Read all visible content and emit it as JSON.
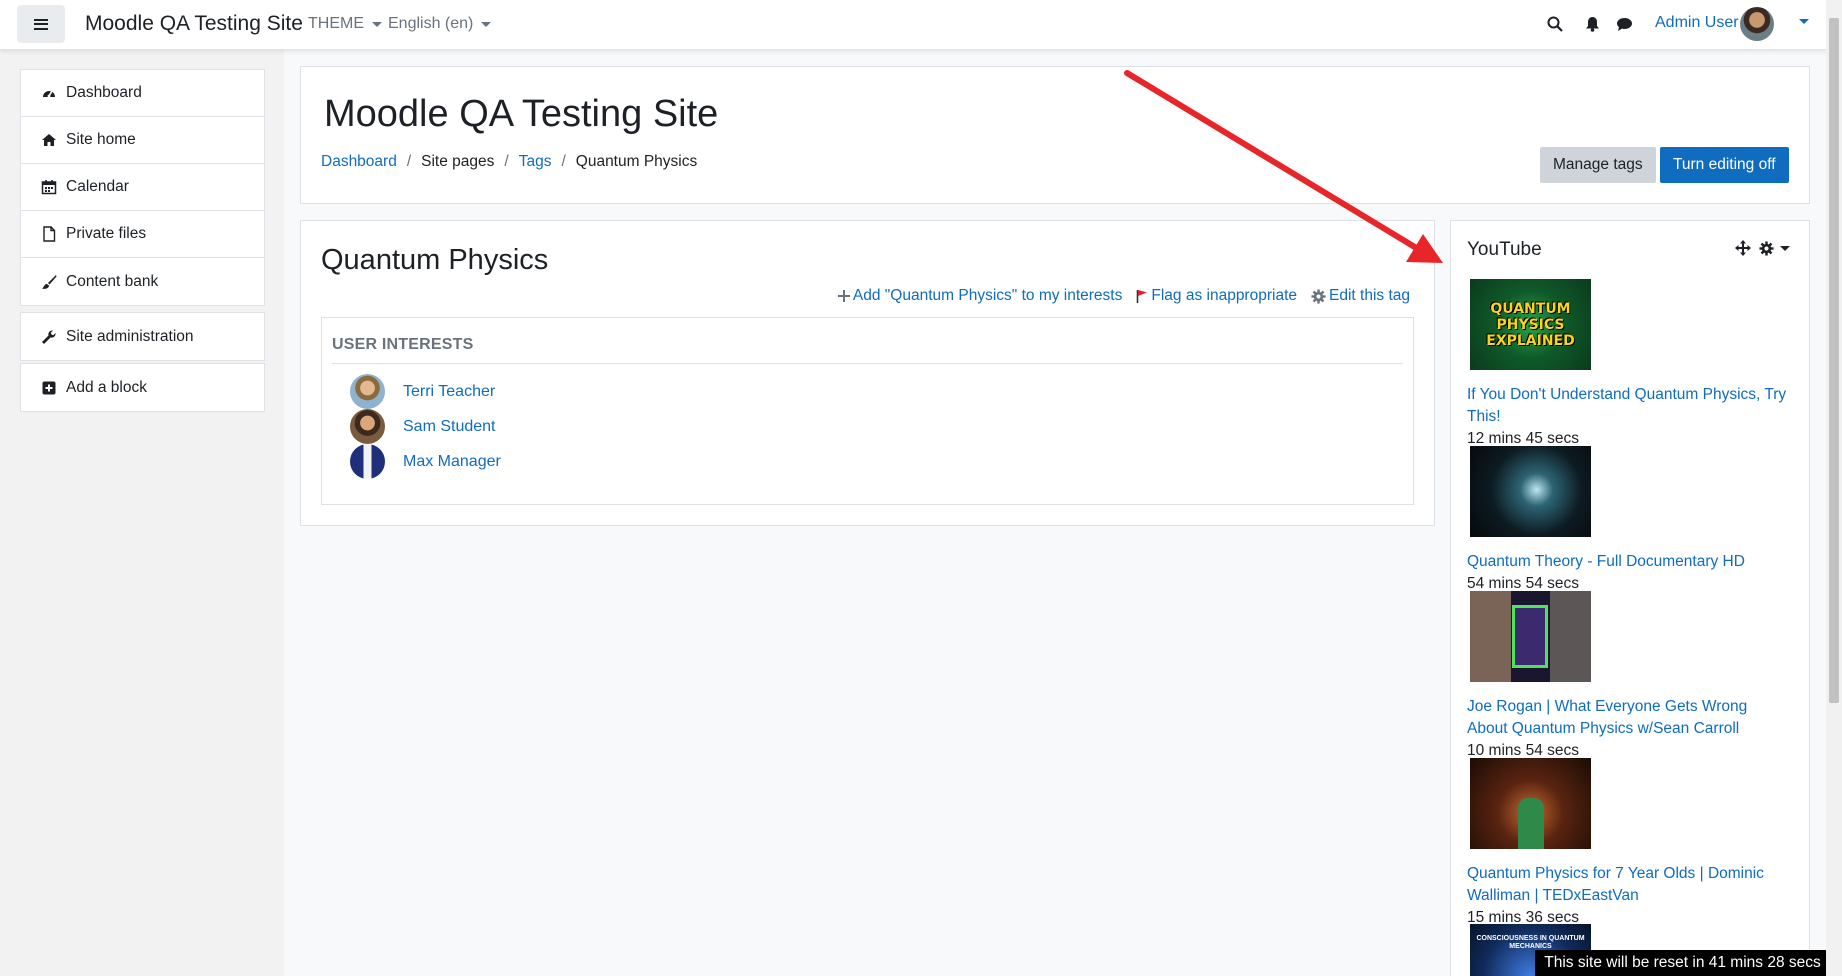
{
  "navbar": {
    "brand": "Moodle QA Testing Site",
    "theme_menu": "THEME",
    "language_menu": "English (en)",
    "user_name": "Admin User"
  },
  "drawer": {
    "items": [
      {
        "label": "Dashboard",
        "icon": "dashboard-icon"
      },
      {
        "label": "Site home",
        "icon": "home-icon"
      },
      {
        "label": "Calendar",
        "icon": "calendar-icon"
      },
      {
        "label": "Private files",
        "icon": "file-icon"
      },
      {
        "label": "Content bank",
        "icon": "brush-icon"
      }
    ],
    "admin": {
      "label": "Site administration",
      "icon": "wrench-icon"
    },
    "add_block": {
      "label": "Add a block",
      "icon": "plus-square-icon"
    }
  },
  "header": {
    "title": "Moodle QA Testing Site",
    "breadcrumb": [
      "Dashboard",
      "Site pages",
      "Tags",
      "Quantum Physics"
    ],
    "manage_tags": "Manage tags",
    "turn_editing_off": "Turn editing off"
  },
  "tag": {
    "name": "Quantum Physics",
    "add_interest": "Add \"Quantum Physics\" to my interests",
    "flag": "Flag as inappropriate",
    "edit": "Edit this tag",
    "interests_heading": "USER INTERESTS",
    "users": [
      "Terri Teacher",
      "Sam Student",
      "Max Manager"
    ]
  },
  "youtube": {
    "title": "YouTube",
    "videos": [
      {
        "title": "If You Don't Understand Quantum Physics, Try This!",
        "length": "12 mins 45 secs",
        "thumb_text": "QUANTUM PHYSICS EXPLAINED"
      },
      {
        "title": "Quantum Theory - Full Documentary HD",
        "length": "54 mins 54 secs"
      },
      {
        "title": "Joe Rogan | What Everyone Gets Wrong About Quantum Physics w/Sean Carroll",
        "length": "10 mins 54 secs"
      },
      {
        "title": "Quantum Physics for 7 Year Olds | Dominic Walliman | TEDxEastVan",
        "length": "15 mins 36 secs"
      }
    ],
    "fifth_thumb_text": "CONSCIOUSNESS IN QUANTUM MECHANICS"
  },
  "footer": {
    "reset_notice": "This site will be reset in 41 mins 28 secs"
  },
  "colors": {
    "link": "#0f6cbf",
    "primary": "#0f6cbf",
    "annotation_arrow": "#e8262a"
  }
}
